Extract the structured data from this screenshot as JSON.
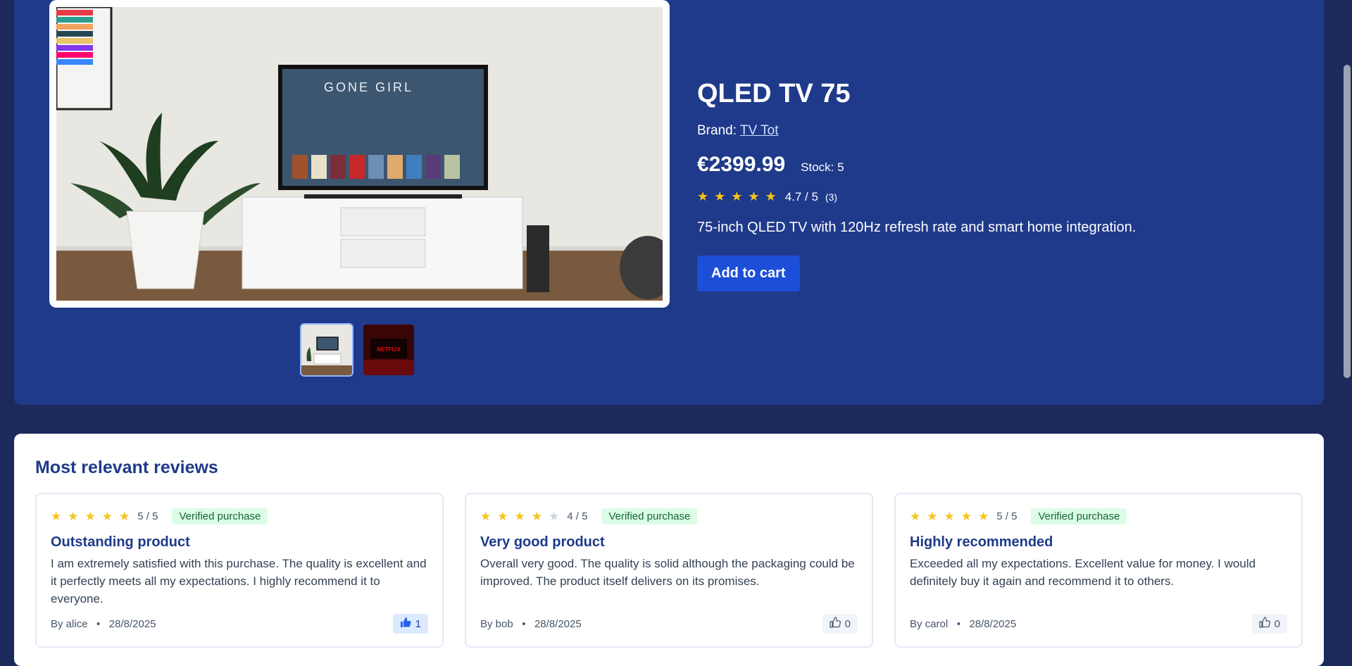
{
  "product": {
    "title": "QLED TV 75",
    "brand_label": "Brand:",
    "brand_name": "TV Tot",
    "price": "€2399.99",
    "stock": "Stock: 5",
    "rating_text": "4.7 / 5",
    "rating_count": "(3)",
    "rating_value": 4.7,
    "description": "75-inch QLED TV with 120Hz refresh rate and smart home integration.",
    "add_to_cart": "Add to cart",
    "image_text": {
      "movie_title": "GONE GIRL",
      "thumb2_text": "NETFLIX"
    }
  },
  "reviews": {
    "title": "Most relevant reviews",
    "items": [
      {
        "stars": 5,
        "score": "5 / 5",
        "verified": "Verified purchase",
        "heading": "Outstanding product",
        "body": "I am extremely satisfied with this purchase. The quality is excellent and it perfectly meets all my expectations. I highly recommend it to everyone.",
        "author": "By alice",
        "date": "28/8/2025",
        "likes": "1"
      },
      {
        "stars": 4,
        "score": "4 / 5",
        "verified": "Verified purchase",
        "heading": "Very good product",
        "body": "Overall very good. The quality is solid although the packaging could be improved. The product itself delivers on its promises.",
        "author": "By bob",
        "date": "28/8/2025",
        "likes": "0"
      },
      {
        "stars": 5,
        "score": "5 / 5",
        "verified": "Verified purchase",
        "heading": "Highly recommended",
        "body": "Exceeded all my expectations. Excellent value for money. I would definitely buy it again and recommend it to others.",
        "author": "By carol",
        "date": "28/8/2025",
        "likes": "0"
      }
    ]
  },
  "colors": {
    "page_bg": "#1b2a5a",
    "panel_bg": "#1f3a8a",
    "accent": "#1d4ed8",
    "star": "#f5c518"
  }
}
